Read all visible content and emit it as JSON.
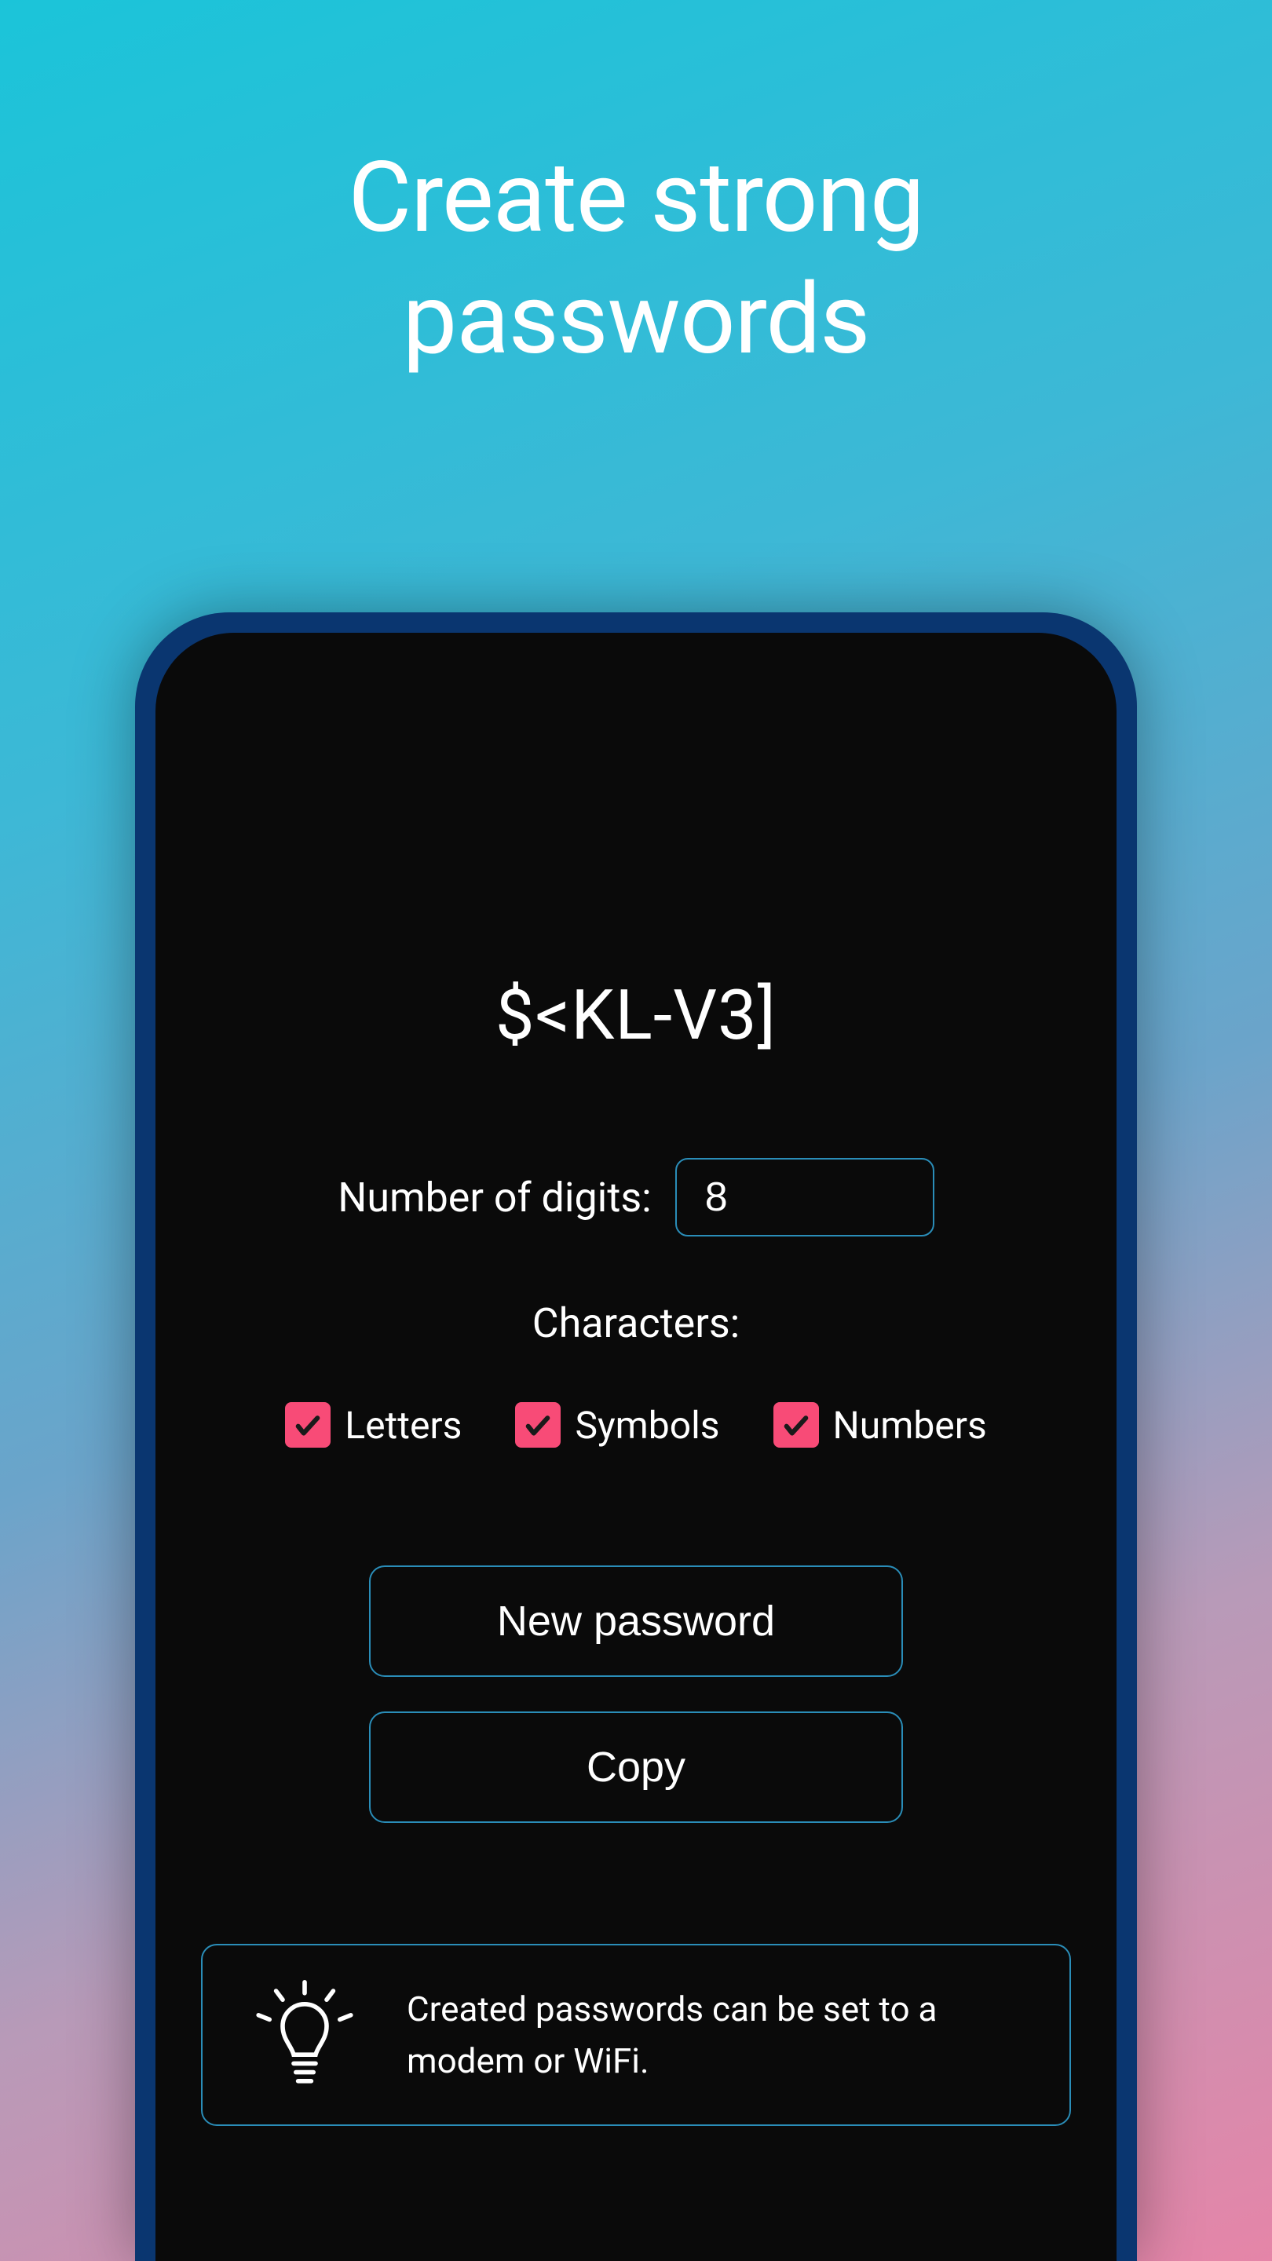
{
  "header": {
    "title_line1": "Create strong",
    "title_line2": "passwords"
  },
  "generator": {
    "password": "$<KL-V3]",
    "digits_label": "Number of digits:",
    "digits_value": "8",
    "characters_label": "Characters:",
    "options": {
      "letters": {
        "label": "Letters",
        "checked": true
      },
      "symbols": {
        "label": "Symbols",
        "checked": true
      },
      "numbers": {
        "label": "Numbers",
        "checked": true
      }
    }
  },
  "actions": {
    "new_password_label": "New password",
    "copy_label": "Copy"
  },
  "info": {
    "text": "Created passwords can be set to a modem or WiFi."
  }
}
